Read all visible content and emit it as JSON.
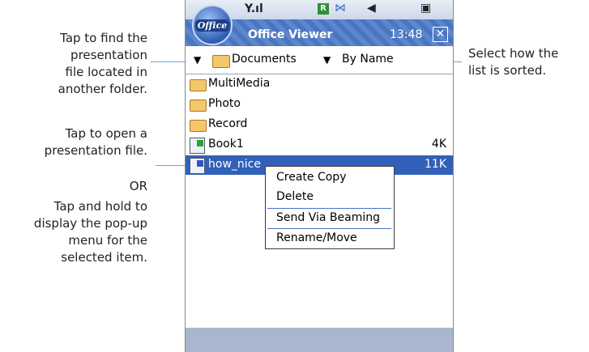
{
  "callouts": {
    "find_folder": [
      "Tap to find the",
      "presentation",
      "file located in",
      "another folder."
    ],
    "open_file": [
      "Tap to open a",
      "presentation file."
    ],
    "or": "OR",
    "tap_hold": [
      "Tap and hold to",
      "display the pop-up",
      "menu for the",
      "selected item."
    ],
    "sort": [
      "Select how the",
      "list is sorted."
    ]
  },
  "app": {
    "logo_text": "Office",
    "title": "Office Viewer",
    "time": "13:48",
    "status": {
      "roaming_badge": "R"
    }
  },
  "toolbar": {
    "folder": "Documents",
    "sort": "By Name"
  },
  "files": [
    {
      "name": "MultiMedia",
      "type": "folder",
      "size": ""
    },
    {
      "name": "Photo",
      "type": "folder",
      "size": ""
    },
    {
      "name": "Record",
      "type": "folder",
      "size": ""
    },
    {
      "name": "Book1",
      "type": "excel",
      "size": "4K"
    },
    {
      "name": "how_nice",
      "type": "presentation",
      "size": "11K",
      "selected": true
    }
  ],
  "popup_menu": [
    "Create Copy",
    "Delete",
    "Send Via Beaming",
    "Rename/Move"
  ],
  "colors": {
    "accent": "#3160b8",
    "callout_line": "#6fa0d8",
    "title_bar": "#4a76c1",
    "bottom_bar": "#a9b6cd"
  },
  "icons": [
    "signal-icon",
    "roaming-icon",
    "vibrate-icon",
    "speaker-icon",
    "battery-icon",
    "close-icon",
    "folder-icon",
    "excel-file-icon",
    "presentation-file-icon"
  ]
}
